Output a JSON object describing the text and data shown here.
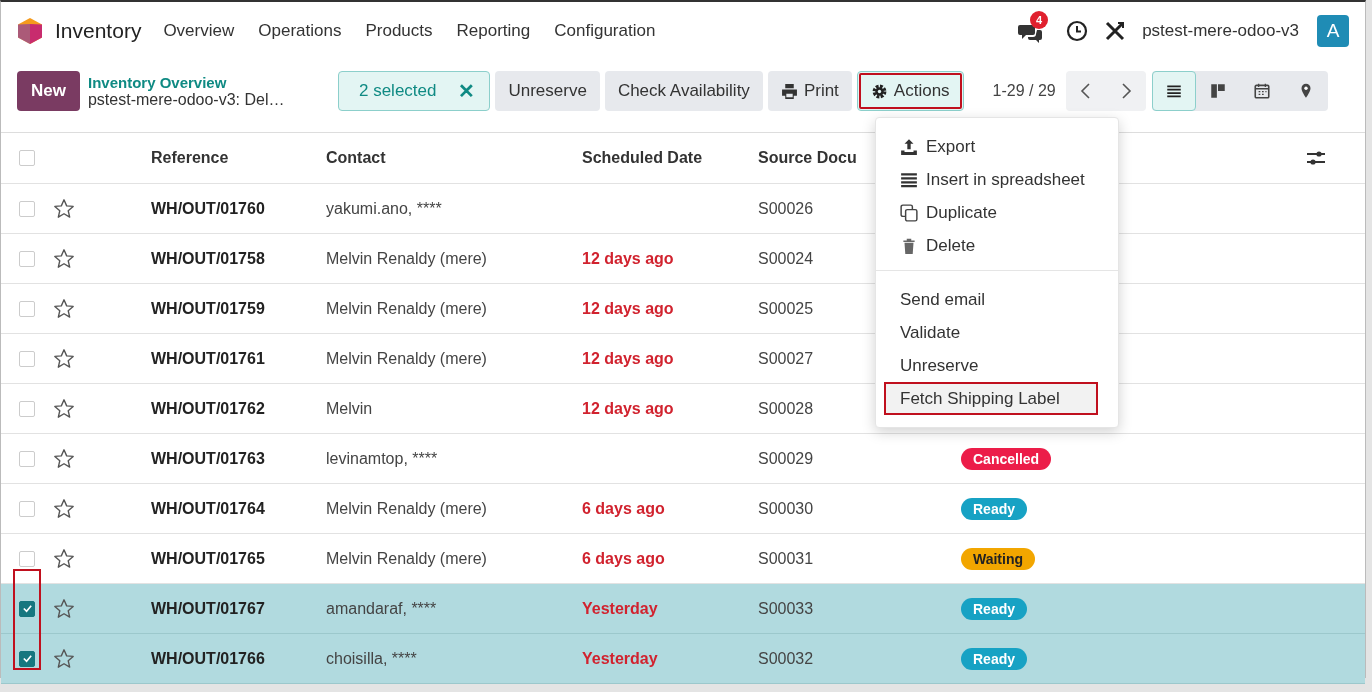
{
  "navbar": {
    "app_name": "Inventory",
    "menu": [
      "Overview",
      "Operations",
      "Products",
      "Reporting",
      "Configuration"
    ],
    "notification_count": "4",
    "company": "pstest-mere-odoo-v3",
    "avatar": "A"
  },
  "control_bar": {
    "new_button": "New",
    "breadcrumb": "Inventory Overview",
    "title": "pstest-mere-odoo-v3: Del…",
    "selection": "2 selected",
    "clear_selection": "✕",
    "buttons": [
      "Unreserve",
      "Check Availability"
    ],
    "print_button": "Print",
    "actions_button": {
      "label": "Actions",
      "highlighted": true
    },
    "pager": "1-29 / 29",
    "views": [
      {
        "kind": "list",
        "selected": true
      },
      {
        "kind": "kanban",
        "selected": false
      },
      {
        "kind": "calendar",
        "selected": false
      },
      {
        "kind": "map",
        "selected": false
      }
    ]
  },
  "table": {
    "columns": [
      "Reference",
      "Contact",
      "Scheduled Date",
      "Source Docu"
    ],
    "checkbox_column_highlighted": true,
    "all_selected": false,
    "rows": [
      {
        "selected": false,
        "reference": "WH/OUT/01760",
        "contact": "yakumi.ano, ****",
        "source": "S00026"
      },
      {
        "selected": false,
        "reference": "WH/OUT/01758",
        "contact": "Melvin Renaldy (mere)",
        "date": "12 days ago",
        "source": "S00024"
      },
      {
        "selected": false,
        "reference": "WH/OUT/01759",
        "contact": "Melvin Renaldy (mere)",
        "date": "12 days ago",
        "source": "S00025"
      },
      {
        "selected": false,
        "reference": "WH/OUT/01761",
        "contact": "Melvin Renaldy (mere)",
        "date": "12 days ago",
        "source": "S00027"
      },
      {
        "selected": false,
        "reference": "WH/OUT/01762",
        "contact": "Melvin",
        "date": "12 days ago",
        "source": "S00028"
      },
      {
        "selected": false,
        "reference": "WH/OUT/01763",
        "contact": "levinamtop, ****",
        "source": "S00029",
        "status": {
          "label": "Cancelled",
          "kind": "danger"
        }
      },
      {
        "selected": false,
        "reference": "WH/OUT/01764",
        "contact": "Melvin Renaldy (mere)",
        "date": "6 days ago",
        "source": "S00030",
        "status": {
          "label": "Ready",
          "kind": "info"
        }
      },
      {
        "selected": false,
        "reference": "WH/OUT/01765",
        "contact": "Melvin Renaldy (mere)",
        "date": "6 days ago",
        "source": "S00031",
        "status": {
          "label": "Waiting",
          "kind": "warning"
        }
      },
      {
        "selected": true,
        "reference": "WH/OUT/01767",
        "contact": "amandaraf, ****",
        "date": "Yesterday",
        "source": "S00033",
        "status": {
          "label": "Ready",
          "kind": "info"
        }
      },
      {
        "selected": true,
        "reference": "WH/OUT/01766",
        "contact": "choisilla, ****",
        "date": "Yesterday",
        "source": "S00032",
        "status": {
          "label": "Ready",
          "kind": "info"
        }
      }
    ]
  },
  "actions_menu": {
    "groups": [
      [
        {
          "kind": "export",
          "label": "Export",
          "highlighted": false
        },
        {
          "kind": "spreadsheet",
          "label": "Insert in spreadsheet",
          "highlighted": false
        },
        {
          "kind": "duplicate",
          "label": "Duplicate",
          "highlighted": false
        },
        {
          "kind": "delete",
          "label": "Delete",
          "highlighted": false
        }
      ],
      [
        {
          "kind": "plain",
          "label": "Send email",
          "highlighted": false
        },
        {
          "kind": "plain",
          "label": "Validate",
          "highlighted": false
        },
        {
          "kind": "plain",
          "label": "Unreserve",
          "highlighted": false
        },
        {
          "kind": "plain",
          "label": "Fetch Shipping Label",
          "highlighted": true
        }
      ]
    ]
  }
}
